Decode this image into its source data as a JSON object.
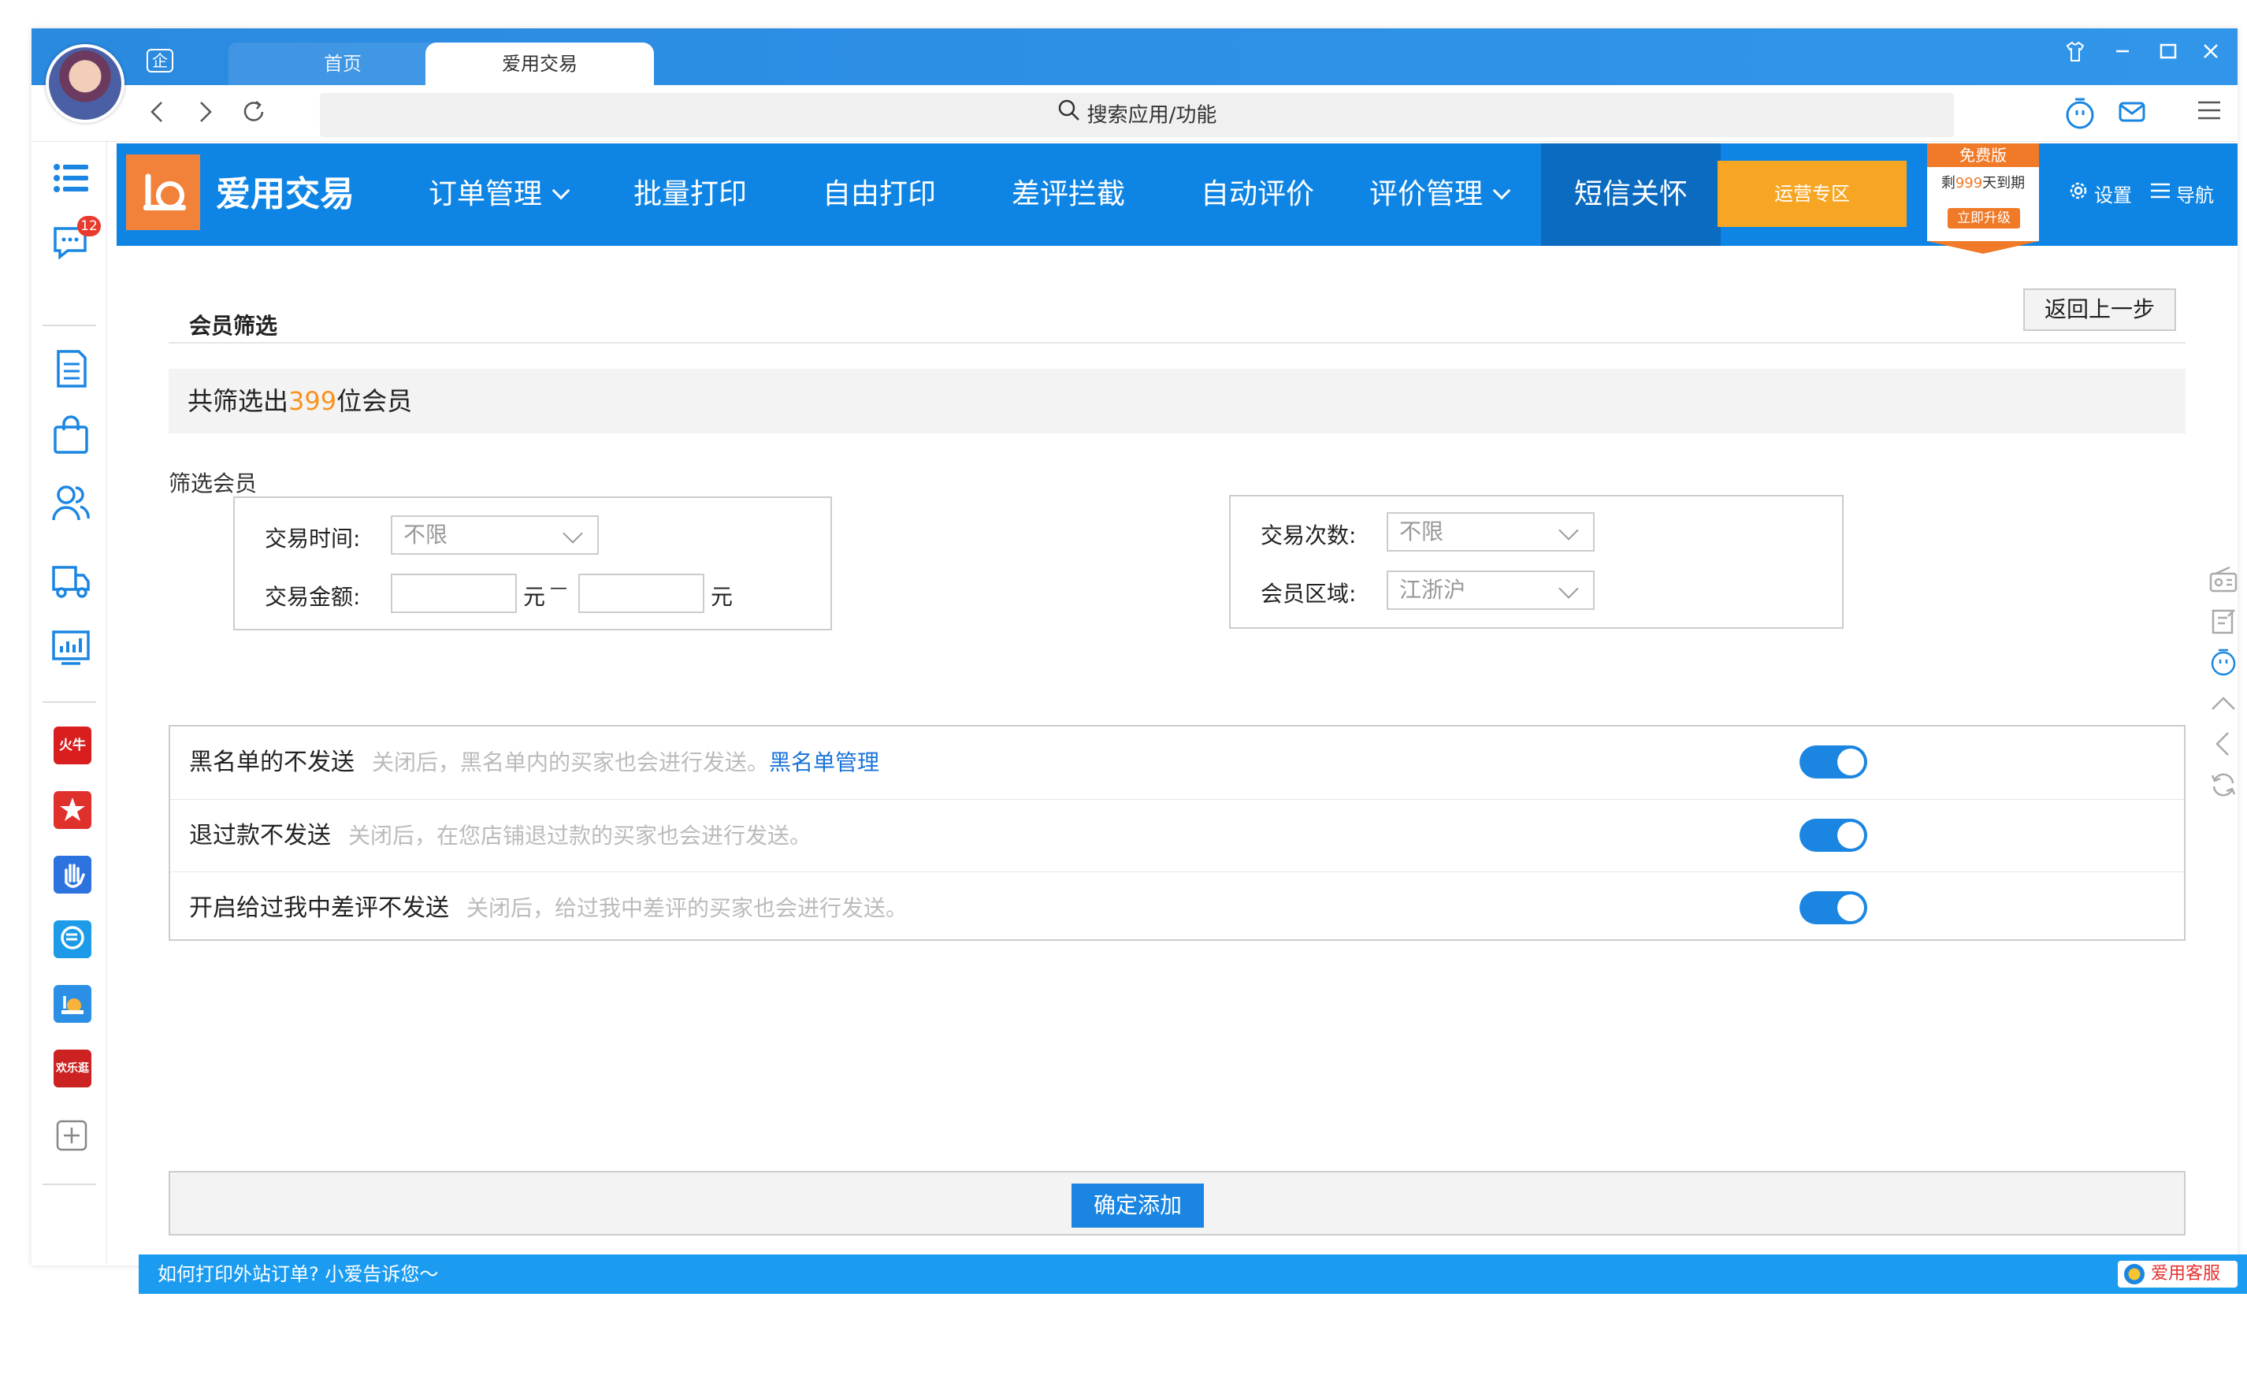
{
  "browser": {
    "tabs": [
      {
        "label": "首页"
      },
      {
        "label": "爱用交易"
      }
    ],
    "enterprise_icon": "企",
    "search_placeholder": "搜索应用/功能"
  },
  "sidebar": {
    "badge_count": "12",
    "apps": [
      {
        "name": "火牛",
        "color": "#d81e1e"
      },
      {
        "name": "star",
        "color": "#e0302c"
      },
      {
        "name": "hand",
        "color": "#2c73e0"
      },
      {
        "name": "erp",
        "color": "#1d9be8"
      },
      {
        "name": "snail",
        "color": "#2b8fe6"
      },
      {
        "name": "欢乐逛",
        "color": "#cc2222"
      }
    ]
  },
  "header": {
    "brand": "爱用交易",
    "menu": [
      {
        "label": "订单管理",
        "has_dropdown": true
      },
      {
        "label": "批量打印"
      },
      {
        "label": "自由打印"
      },
      {
        "label": "差评拦截"
      },
      {
        "label": "自动评价"
      },
      {
        "label": "评价管理",
        "has_dropdown": true
      },
      {
        "label": "短信关怀",
        "active": true
      }
    ],
    "ops_zone": "运营专区",
    "free_badge": {
      "title": "免费版",
      "remain_prefix": "剩",
      "remain_days": "999",
      "remain_suffix": "天到期",
      "upgrade": "立即升级"
    },
    "settings": "设置",
    "nav": "导航"
  },
  "page": {
    "section_title": "会员筛选",
    "back_button": "返回上一步",
    "summary_prefix": "共筛选出",
    "summary_count": "399",
    "summary_suffix": "位会员",
    "filter_label": "筛选会员",
    "left_filters": {
      "trade_time_label": "交易时间:",
      "trade_time_value": "不限",
      "trade_amount_label": "交易金额:",
      "unit": "元",
      "dash": "—"
    },
    "right_filters": {
      "trade_count_label": "交易次数:",
      "trade_count_value": "不限",
      "region_label": "会员区域:",
      "region_value": "江浙沪"
    },
    "options": [
      {
        "title": "黑名单的不发送",
        "desc": "关闭后，黑名单内的买家也会进行发送。",
        "link": "黑名单管理",
        "on": true
      },
      {
        "title": "退过款不发送",
        "desc": "关闭后，在您店铺退过款的买家也会进行发送。",
        "on": true
      },
      {
        "title": "开启给过我中差评不发送",
        "desc": "关闭后，给过我中差评的买家也会进行发送。",
        "on": true
      }
    ],
    "confirm_button": "确定添加"
  },
  "statusbar": {
    "message": "如何打印外站订单? 小爱告诉您～",
    "kefu": "爱用客服"
  }
}
